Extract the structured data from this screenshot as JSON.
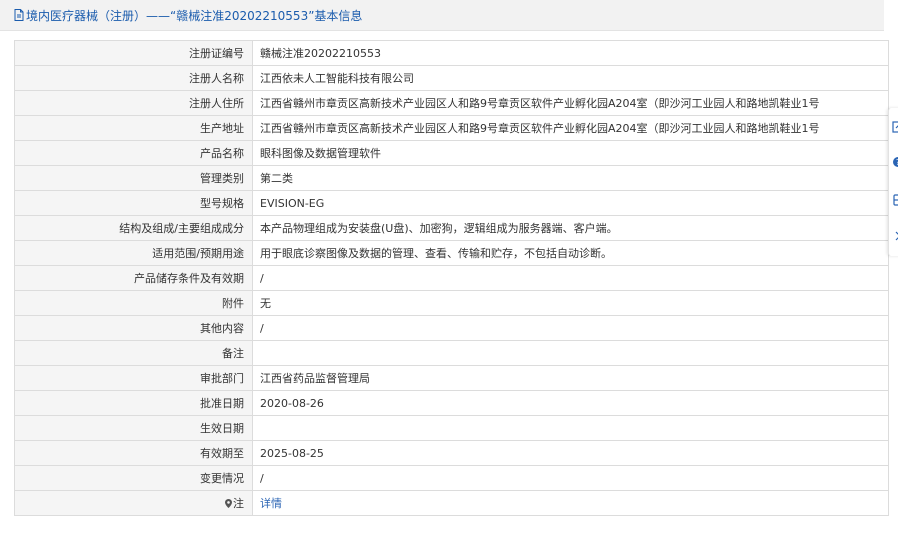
{
  "header": {
    "title": "境内医疗器械（注册）——“赣械注准20202210553”基本信息"
  },
  "rows": [
    {
      "label": "注册证编号",
      "value": "赣械注准20202210553"
    },
    {
      "label": "注册人名称",
      "value": "江西依未人工智能科技有限公司"
    },
    {
      "label": "注册人住所",
      "value": "江西省赣州市章贡区高新技术产业园区人和路9号章贡区软件产业孵化园A204室（即沙河工业园人和路地凯鞋业1号"
    },
    {
      "label": "生产地址",
      "value": "江西省赣州市章贡区高新技术产业园区人和路9号章贡区软件产业孵化园A204室（即沙河工业园人和路地凯鞋业1号"
    },
    {
      "label": "产品名称",
      "value": "眼科图像及数据管理软件"
    },
    {
      "label": "管理类别",
      "value": "第二类"
    },
    {
      "label": "型号规格",
      "value": "EVISION-EG"
    },
    {
      "label": "结构及组成/主要组成成分",
      "value": "本产品物理组成为安装盘(U盘)、加密狗，逻辑组成为服务器端、客户端。"
    },
    {
      "label": "适用范围/预期用途",
      "value": "用于眼底诊察图像及数据的管理、查看、传输和贮存，不包括自动诊断。"
    },
    {
      "label": "产品储存条件及有效期",
      "value": "/"
    },
    {
      "label": "附件",
      "value": "无"
    },
    {
      "label": "其他内容",
      "value": "/"
    },
    {
      "label": "备注",
      "value": ""
    },
    {
      "label": "审批部门",
      "value": "江西省药品监督管理局"
    },
    {
      "label": "批准日期",
      "value": "2020-08-26"
    },
    {
      "label": "生效日期",
      "value": ""
    },
    {
      "label": "有效期至",
      "value": "2025-08-25"
    },
    {
      "label": "变更情况",
      "value": "/"
    }
  ],
  "note_row": {
    "label": "注",
    "link_text": "详情",
    "icon": "map-pin-icon"
  },
  "side_tools": [
    {
      "icon": "edit-icon"
    },
    {
      "icon": "help-icon"
    },
    {
      "icon": "phone-icon"
    },
    {
      "icon": "chevron-right-icon"
    }
  ],
  "colors": {
    "link": "#2a64b4",
    "header_text": "#1b5cad",
    "label_bg": "#f5f5f5",
    "border": "#dcdcdc"
  }
}
